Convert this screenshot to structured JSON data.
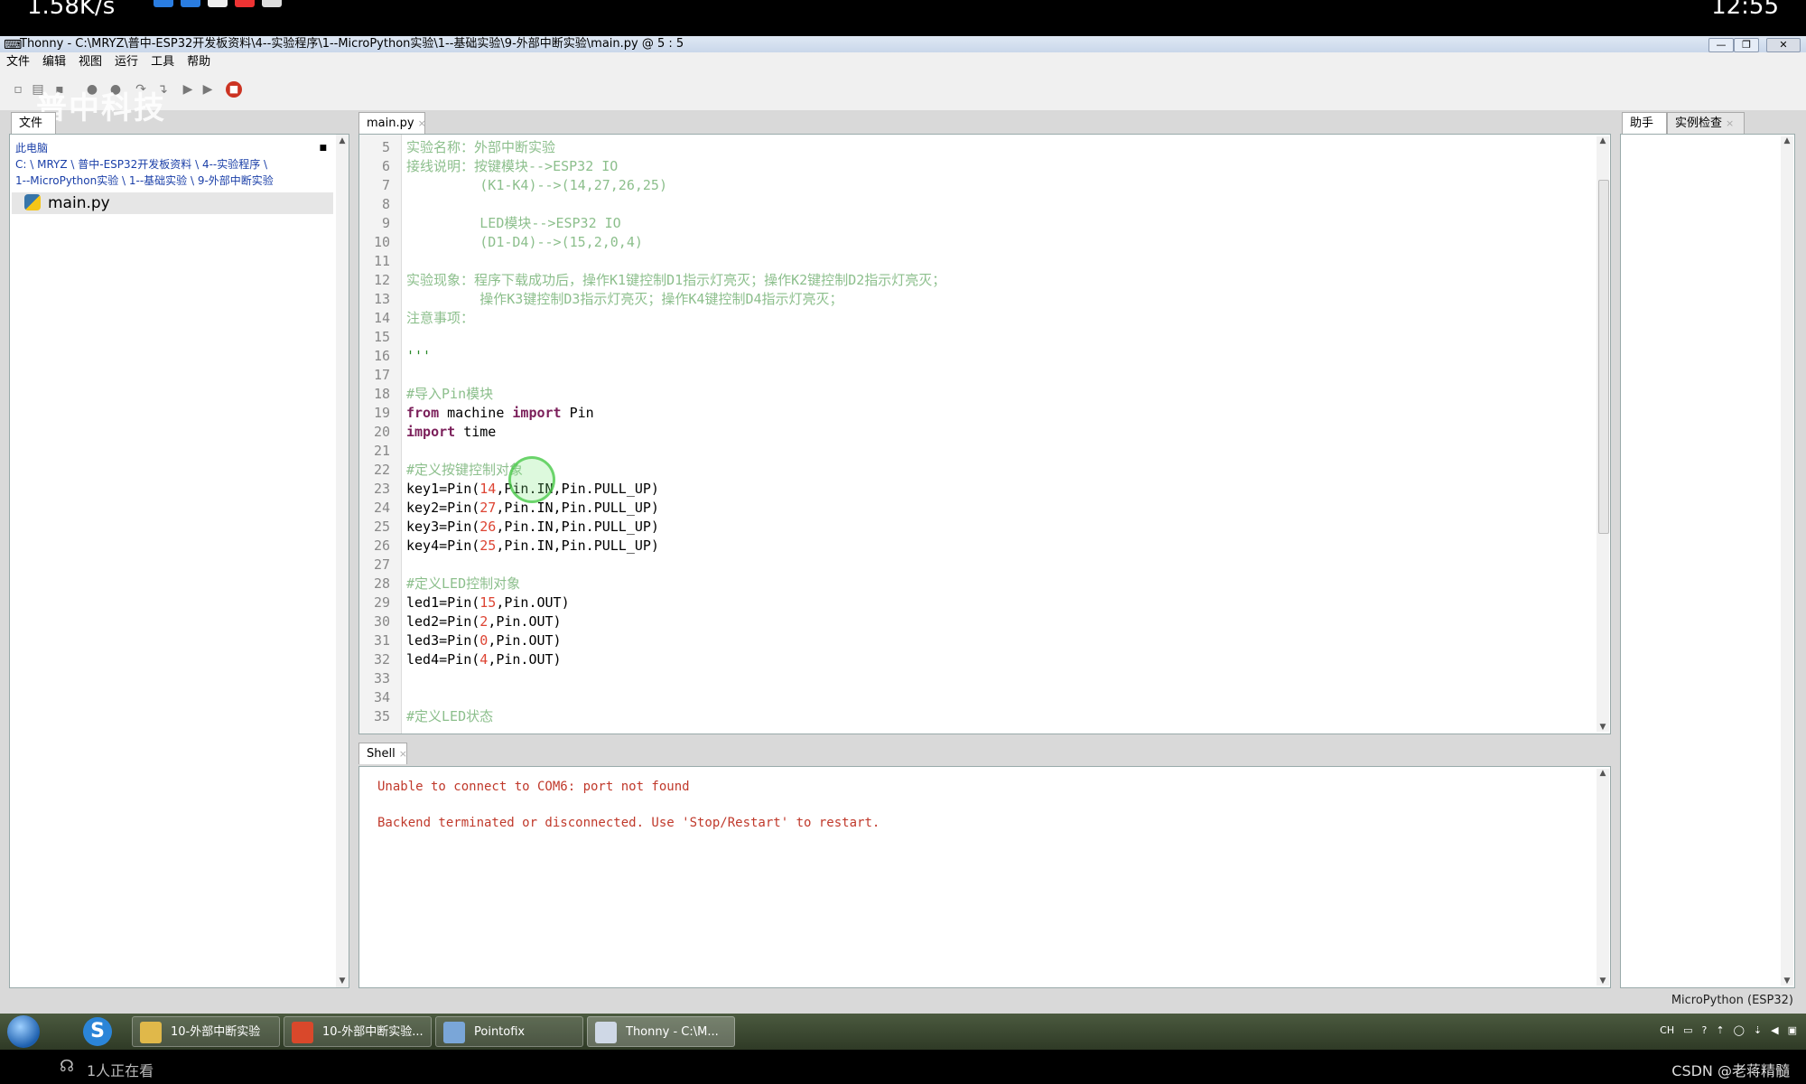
{
  "phone_status": {
    "net_speed": "1.58K/s",
    "time": "12:55"
  },
  "window": {
    "title": "Thonny  -  C:\\MRYZ\\普中-ESP32开发板资料\\4--实验程序\\1--MicroPython实验\\1--基础实验\\9-外部中断实验\\main.py  @  5 : 5",
    "controls": [
      "—",
      "❐",
      "✕"
    ]
  },
  "menu": [
    "文件",
    "编辑",
    "视图",
    "运行",
    "工具",
    "帮助"
  ],
  "watermark": "普中科技",
  "files": {
    "tab_label": "文件",
    "location_root": "此电脑",
    "path_line1": "C: \\ MRYZ \\ 普中-ESP32开发板资料 \\ 4--实验程序 \\",
    "path_line2": "1--MicroPython实验 \\ 1--基础实验 \\ 9-外部中断实验",
    "items": [
      {
        "name": "main.py"
      }
    ]
  },
  "editor": {
    "tab_label": "main.py",
    "lines": [
      {
        "n": "5",
        "t": [
          [
            "cm",
            "实验名称：外部中断实验"
          ]
        ]
      },
      {
        "n": "6",
        "t": [
          [
            "cm",
            "接线说明：按键模块-->ESP32 IO"
          ]
        ]
      },
      {
        "n": "7",
        "t": [
          [
            "cm",
            "         (K1-K4)-->(14,27,26,25)"
          ]
        ]
      },
      {
        "n": "8",
        "t": []
      },
      {
        "n": "9",
        "t": [
          [
            "cm",
            "         LED模块-->ESP32 IO"
          ]
        ]
      },
      {
        "n": "10",
        "t": [
          [
            "cm",
            "         (D1-D4)-->(15,2,0,4)"
          ]
        ]
      },
      {
        "n": "11",
        "t": []
      },
      {
        "n": "12",
        "t": [
          [
            "cm",
            "实验现象：程序下载成功后，操作K1键控制D1指示灯亮灭；操作K2键控制D2指示灯亮灭；"
          ]
        ]
      },
      {
        "n": "13",
        "t": [
          [
            "cm",
            "         操作K3键控制D3指示灯亮灭；操作K4键控制D4指示灯亮灭；"
          ]
        ]
      },
      {
        "n": "14",
        "t": [
          [
            "cm",
            "注意事项："
          ]
        ]
      },
      {
        "n": "15",
        "t": []
      },
      {
        "n": "16",
        "t": [
          [
            "str",
            "'''"
          ]
        ]
      },
      {
        "n": "17",
        "t": []
      },
      {
        "n": "18",
        "t": [
          [
            "cm",
            "#导入Pin模块"
          ]
        ]
      },
      {
        "n": "19",
        "t": [
          [
            "kw",
            "from"
          ],
          [
            "",
            " machine "
          ],
          [
            "kw",
            "import"
          ],
          [
            "",
            " Pin"
          ]
        ]
      },
      {
        "n": "20",
        "t": [
          [
            "kw",
            "import"
          ],
          [
            "",
            " time"
          ]
        ]
      },
      {
        "n": "21",
        "t": []
      },
      {
        "n": "22",
        "t": [
          [
            "cm",
            "#定义按键控制对象"
          ]
        ]
      },
      {
        "n": "23",
        "t": [
          [
            "",
            "key1=Pin("
          ],
          [
            "num",
            "14"
          ],
          [
            "",
            ",Pin.IN,Pin.PULL_UP)"
          ]
        ]
      },
      {
        "n": "24",
        "t": [
          [
            "",
            "key2=Pin("
          ],
          [
            "num",
            "27"
          ],
          [
            "",
            ",Pin.IN,Pin.PULL_UP)"
          ]
        ]
      },
      {
        "n": "25",
        "t": [
          [
            "",
            "key3=Pin("
          ],
          [
            "num",
            "26"
          ],
          [
            "",
            ",Pin.IN,Pin.PULL_UP)"
          ]
        ]
      },
      {
        "n": "26",
        "t": [
          [
            "",
            "key4=Pin("
          ],
          [
            "num",
            "25"
          ],
          [
            "",
            ",Pin.IN,Pin.PULL_UP)"
          ]
        ]
      },
      {
        "n": "27",
        "t": []
      },
      {
        "n": "28",
        "t": [
          [
            "cm",
            "#定义LED控制对象"
          ]
        ]
      },
      {
        "n": "29",
        "t": [
          [
            "",
            "led1=Pin("
          ],
          [
            "num",
            "15"
          ],
          [
            "",
            ",Pin.OUT)"
          ]
        ]
      },
      {
        "n": "30",
        "t": [
          [
            "",
            "led2=Pin("
          ],
          [
            "num",
            "2"
          ],
          [
            "",
            ",Pin.OUT)"
          ]
        ]
      },
      {
        "n": "31",
        "t": [
          [
            "",
            "led3=Pin("
          ],
          [
            "num",
            "0"
          ],
          [
            "",
            ",Pin.OUT)"
          ]
        ]
      },
      {
        "n": "32",
        "t": [
          [
            "",
            "led4=Pin("
          ],
          [
            "num",
            "4"
          ],
          [
            "",
            ",Pin.OUT)"
          ]
        ]
      },
      {
        "n": "33",
        "t": []
      },
      {
        "n": "34",
        "t": []
      },
      {
        "n": "35",
        "t": [
          [
            "cm",
            "#定义LED状态"
          ]
        ]
      }
    ]
  },
  "shell": {
    "tab_label": "Shell",
    "output": "Unable to connect to COM6: port not found\n\nBackend terminated or disconnected. Use 'Stop/Restart' to restart."
  },
  "assistant": {
    "tab_help": "助手",
    "tab_inspect": "实例检查"
  },
  "interpreter": "MicroPython (ESP32)",
  "taskbar": {
    "items": [
      {
        "label": "10-外部中断实验",
        "color": "#e0b84a"
      },
      {
        "label": "10-外部中断实验...",
        "color": "#d9482b"
      },
      {
        "label": "Pointofix",
        "color": "#7aa6d8"
      },
      {
        "label": "Thonny  -  C:\\M...",
        "color": "#cfd8e6"
      }
    ],
    "tray": [
      "CH",
      "▭",
      "?",
      "⇡",
      "◯",
      "⇣",
      "◀",
      "▣"
    ]
  },
  "live": {
    "viewers": "1人正在看",
    "brand": "CSDN @老蒋精髓"
  }
}
